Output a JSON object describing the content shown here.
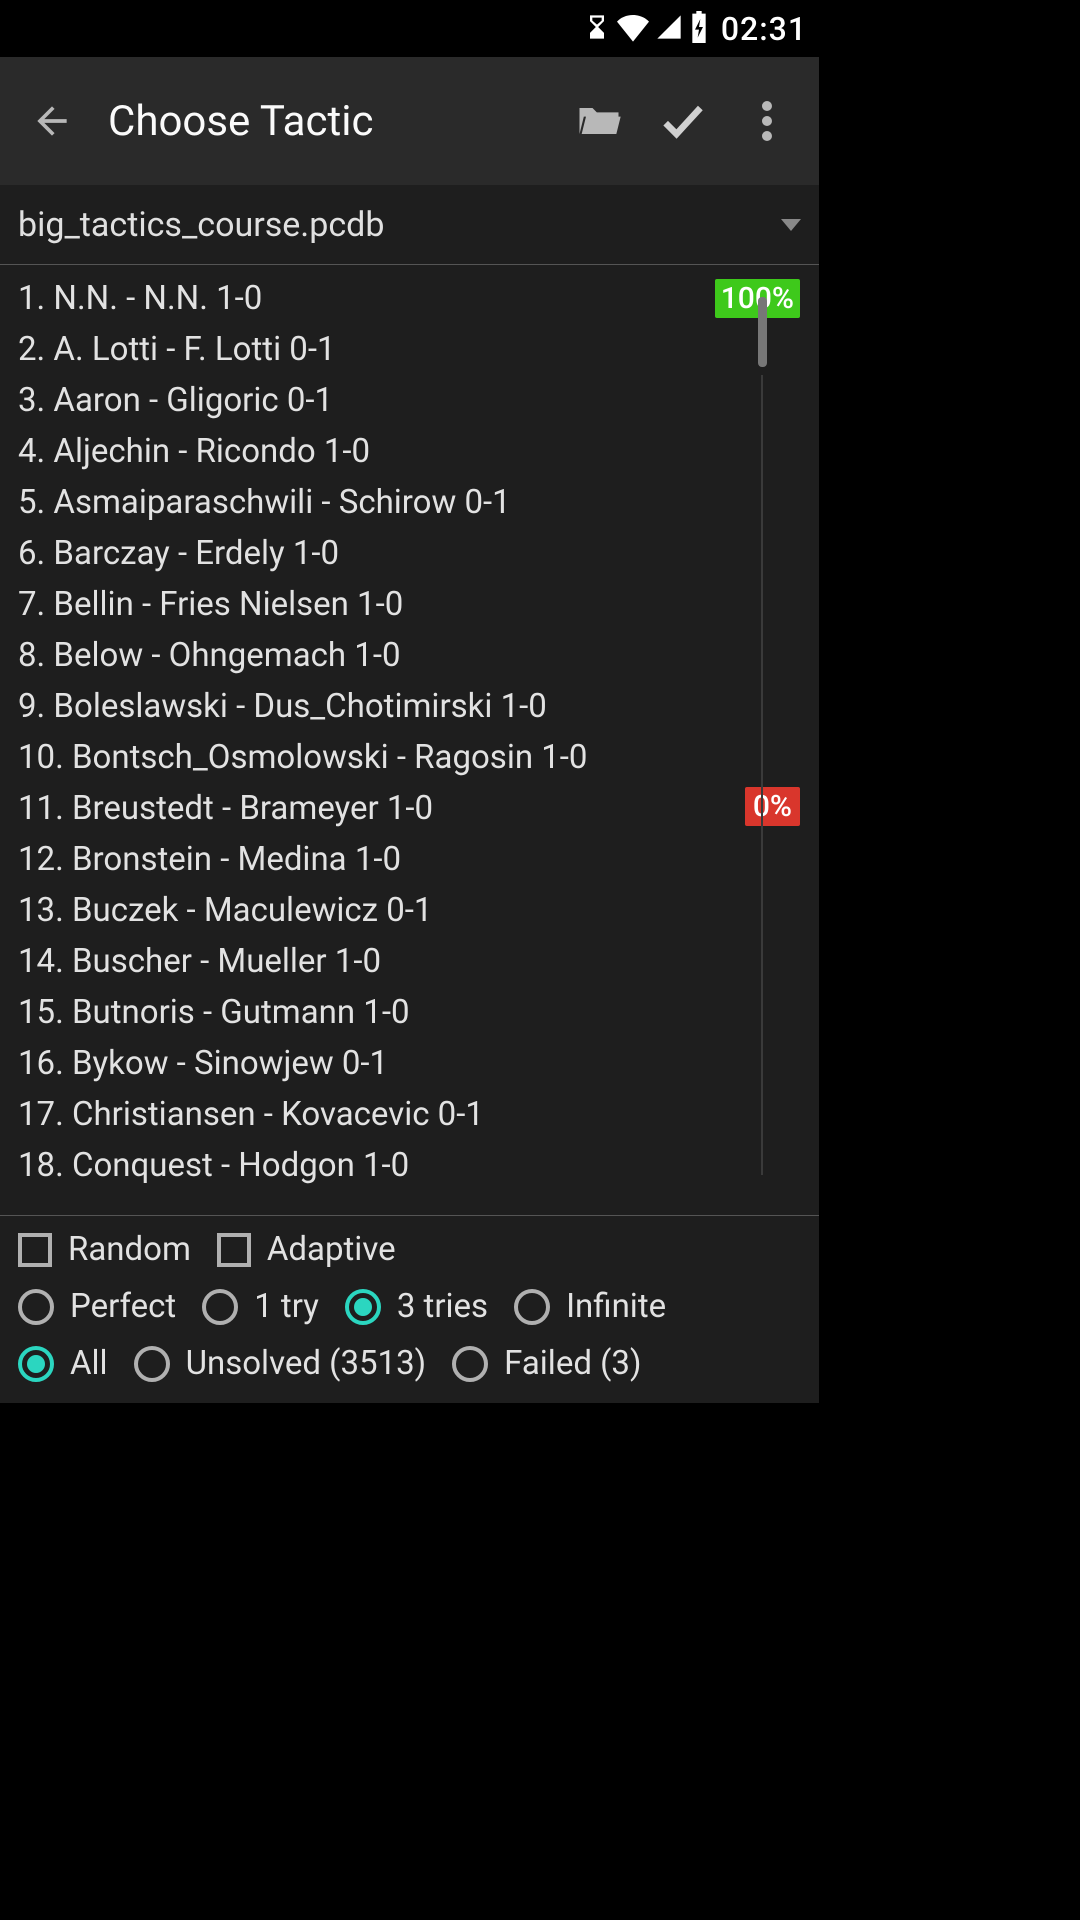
{
  "status": {
    "time": "02:31"
  },
  "toolbar": {
    "title": "Choose Tactic"
  },
  "file": {
    "name": "big_tactics_course.pcdb"
  },
  "badges": {
    "first": "100%",
    "eleven": "0%"
  },
  "list": {
    "items": [
      {
        "label": "1. N.N. - N.N. 1-0"
      },
      {
        "label": "2. A. Lotti - F. Lotti 0-1"
      },
      {
        "label": "3. Aaron - Gligoric 0-1"
      },
      {
        "label": "4. Aljechin - Ricondo 1-0"
      },
      {
        "label": "5. Asmaiparaschwili - Schirow 0-1"
      },
      {
        "label": "6. Barczay - Erdely 1-0"
      },
      {
        "label": "7. Bellin - Fries Nielsen 1-0"
      },
      {
        "label": "8. Below - Ohngemach 1-0"
      },
      {
        "label": "9. Boleslawski - Dus_Chotimirski 1-0"
      },
      {
        "label": "10. Bontsch_Osmolowski - Ragosin 1-0"
      },
      {
        "label": "11. Breustedt - Brameyer 1-0"
      },
      {
        "label": "12. Bronstein - Medina 1-0"
      },
      {
        "label": "13. Buczek - Maculewicz 0-1"
      },
      {
        "label": "14. Buscher - Mueller 1-0"
      },
      {
        "label": "15. Butnoris - Gutmann 1-0"
      },
      {
        "label": "16. Bykow - Sinowjew 0-1"
      },
      {
        "label": "17. Christiansen - Kovacevic 0-1"
      },
      {
        "label": "18. Conquest - Hodgon 1-0"
      }
    ]
  },
  "modes": {
    "random": "Random",
    "adaptive": "Adaptive"
  },
  "tries": {
    "perfect": "Perfect",
    "one": "1 try",
    "three": "3 tries",
    "infinite": "Infinite",
    "selected": "three"
  },
  "filter": {
    "all": "All",
    "unsolved": "Unsolved (3513)",
    "failed": "Failed (3)",
    "selected": "all"
  }
}
